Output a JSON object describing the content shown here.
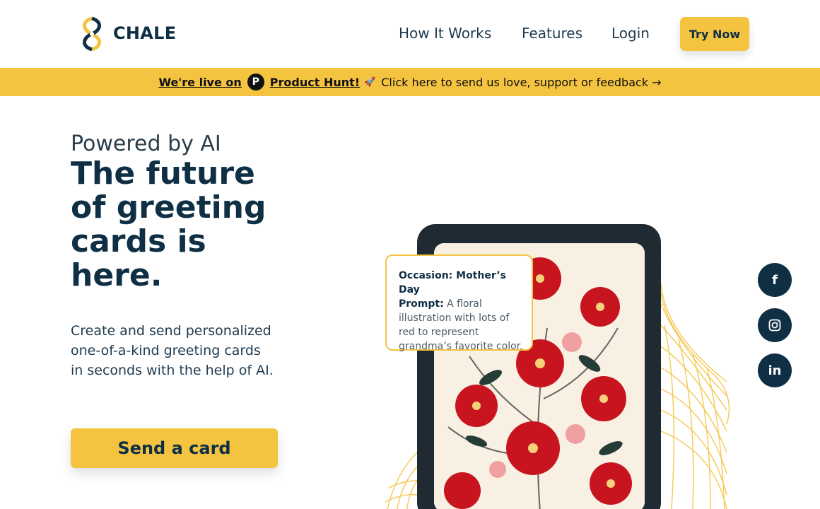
{
  "header": {
    "brand": "CHALE",
    "nav": [
      "How It Works",
      "Features",
      "Login"
    ],
    "cta": "Try Now"
  },
  "banner": {
    "prefix": "We're live on",
    "ph_letter": "P",
    "link": "Product Hunt!",
    "rocket": "🚀",
    "message": "Click here to send us love, support or feedback →"
  },
  "hero": {
    "kicker": "Powered by AI",
    "headline": "The future of greeting cards is here.",
    "description": "Create and send personalized one-of-a-kind greeting cards in seconds with the help of AI.",
    "cta": "Send a card"
  },
  "prompt_card": {
    "occasion": "Occasion: Mother’s Day",
    "prompt_label": "Prompt:",
    "prompt_text": "A floral illustration with lots of red to represent grandma’s favorite color."
  },
  "social": {
    "facebook": "f",
    "linkedin": "in",
    "icons": [
      "facebook-icon",
      "instagram-icon",
      "linkedin-icon"
    ]
  },
  "colors": {
    "accent": "#f4c340",
    "navy": "#0f2f45",
    "phone": "#1f2a33"
  }
}
